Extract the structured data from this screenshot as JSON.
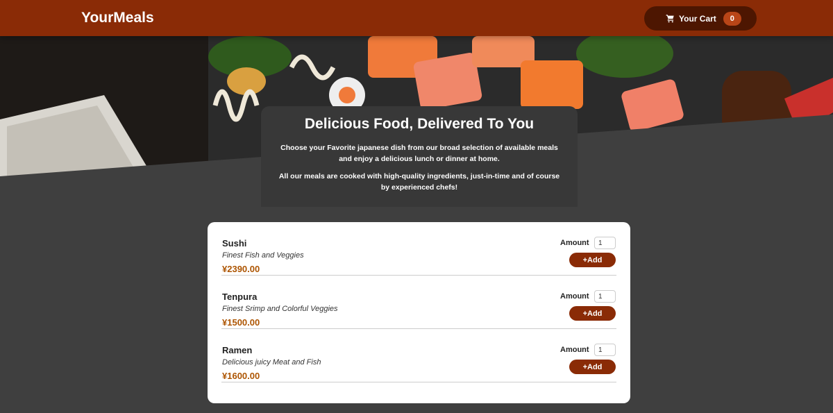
{
  "header": {
    "logo": "YourMeals",
    "cart_label": "Your Cart",
    "cart_count": "0"
  },
  "summary": {
    "title": "Delicious Food, Delivered To You",
    "paragraph1": "Choose your Favorite japanese dish from our broad selection of available meals and enjoy a delicious lunch or dinner at home.",
    "paragraph2": "All our meals are cooked with high-quality ingredients, just-in-time and of course by experienced chefs!"
  },
  "meals": [
    {
      "name": "Sushi",
      "description": "Finest Fish and Veggies",
      "price": "¥2390.00",
      "amount_label": "Amount",
      "amount_value": "1",
      "add_label": "+Add"
    },
    {
      "name": "Tenpura",
      "description": "Finest Srimp and Colorful Veggies",
      "price": "¥1500.00",
      "amount_label": "Amount",
      "amount_value": "1",
      "add_label": "+Add"
    },
    {
      "name": "Ramen",
      "description": "Delicious juicy Meat and Fish",
      "price": "¥1600.00",
      "amount_label": "Amount",
      "amount_value": "1",
      "add_label": "+Add"
    }
  ],
  "colors": {
    "header": "#8a2b06",
    "cart_button": "#4d1601",
    "badge": "#b94517",
    "price": "#ad5502",
    "background": "#3f3f3f"
  },
  "icons": {
    "cart": "cart-icon"
  }
}
